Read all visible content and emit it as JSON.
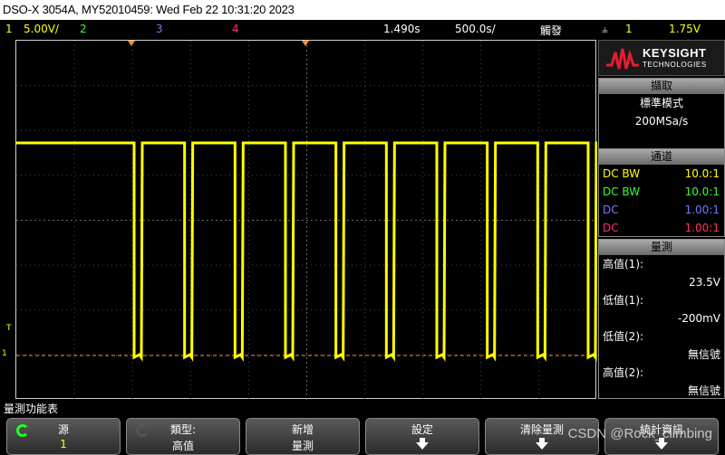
{
  "title": "DSO-X 3054A, MY52010459: Wed Feb 22 10:31:20 2023",
  "channels_bar": {
    "ch1_num": "1",
    "ch1_scale": "5.00V/",
    "ch2_num": "2",
    "ch3_num": "3",
    "ch4_num": "4",
    "delay": "1.490s",
    "timebase": "500.0s/",
    "mode": "觸發",
    "trig_icon": "trigger-icon",
    "trig_ch": "1",
    "trig_level": "1.75V"
  },
  "colors": {
    "ch1": "#ffff00",
    "ch2": "#33ff33",
    "ch3": "#6a6aff",
    "ch4": "#ff3366",
    "trigger_marker": "#ff8c1a"
  },
  "left_markers": {
    "trig_label": "T",
    "ch1_label": "1"
  },
  "logo": {
    "brand": "KEYSIGHT",
    "sub": "TECHNOLOGIES"
  },
  "acquisition": {
    "header": "擷取",
    "mode": "標準模式",
    "rate": "200MSa/s"
  },
  "channels": {
    "header": "通道",
    "rows": [
      {
        "coupling": "DC BW",
        "probe": "10.0:1"
      },
      {
        "coupling": "DC BW",
        "probe": "10.0:1"
      },
      {
        "coupling": "DC",
        "probe": "1.00:1"
      },
      {
        "coupling": "DC",
        "probe": "1.00:1"
      }
    ]
  },
  "measurements": {
    "header": "量測",
    "items": [
      {
        "label": "高值(1):",
        "value": "23.5V"
      },
      {
        "label": "低值(1):",
        "value": "-200mV"
      },
      {
        "label": "低值(2):",
        "value": "無信號"
      },
      {
        "label": "高值(2):",
        "value": "無信號"
      }
    ]
  },
  "softkey_menu_title": "量測功能表",
  "softkeys": [
    {
      "line1": "源",
      "line2": "1"
    },
    {
      "line1": "類型:",
      "line2": "高值"
    },
    {
      "line1": "新增",
      "line2": "量測"
    },
    {
      "line1": "設定",
      "line2": ""
    },
    {
      "line1": "清除量測",
      "line2": ""
    },
    {
      "line1": "統計資訊",
      "line2": ""
    }
  ],
  "watermark": "CSDN @Rock_climbing",
  "chart_data": {
    "type": "line",
    "series": [
      {
        "name": "1",
        "high_V": 23.5,
        "low_V": -0.2,
        "pulse_count": 10
      }
    ],
    "grid": true,
    "volts_per_div": "5.00V/",
    "time_per_div": "500.0s/"
  }
}
